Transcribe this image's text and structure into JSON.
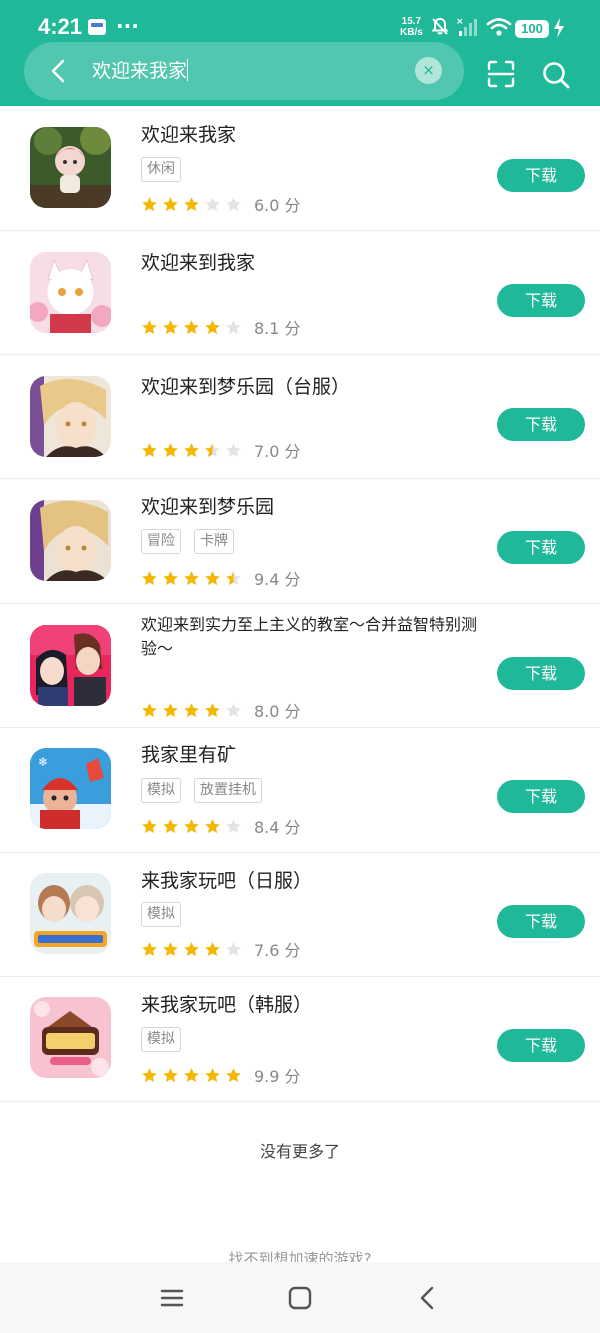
{
  "status_bar": {
    "time": "4:21",
    "speed_value": "15.7",
    "speed_unit": "KB/s",
    "battery": "100",
    "more": "···"
  },
  "search": {
    "query": "欢迎来我家",
    "clear_label": "×",
    "back_icon": "chevron-left-icon",
    "scan_icon": "scan-icon",
    "search_icon": "search-icon"
  },
  "results": [
    {
      "name": "欢迎来我家",
      "tags": [
        "休闲"
      ],
      "stars": 3,
      "score": "6.0 分",
      "button": "下载"
    },
    {
      "name": "欢迎来到我家",
      "tags": [],
      "stars": 4,
      "score": "8.1 分",
      "button": "下载"
    },
    {
      "name": "欢迎来到梦乐园（台服）",
      "tags": [],
      "stars": 3.5,
      "score": "7.0 分",
      "button": "下载"
    },
    {
      "name": "欢迎来到梦乐园",
      "tags": [
        "冒险",
        "卡牌"
      ],
      "stars": 4.5,
      "score": "9.4 分",
      "button": "下载"
    },
    {
      "name": "欢迎来到实力至上主义的教室～合并益智特别测验～",
      "tags": [],
      "stars": 4,
      "score": "8.0 分",
      "button": "下载"
    },
    {
      "name": "我家里有矿",
      "tags": [
        "模拟",
        "放置挂机"
      ],
      "stars": 4,
      "score": "8.4 分",
      "button": "下载"
    },
    {
      "name": "来我家玩吧（日服）",
      "tags": [
        "模拟"
      ],
      "stars": 4,
      "score": "7.6 分",
      "button": "下载"
    },
    {
      "name": "来我家玩吧（韩服）",
      "tags": [
        "模拟"
      ],
      "stars": 5,
      "score": "9.9 分",
      "button": "下载"
    }
  ],
  "footer": {
    "end_text": "没有更多了",
    "hint_text": "找不到想加速的游戏?"
  },
  "colors": {
    "accent": "#1fb898",
    "star_on": "#f5b800",
    "star_off": "#e3e3e3"
  }
}
